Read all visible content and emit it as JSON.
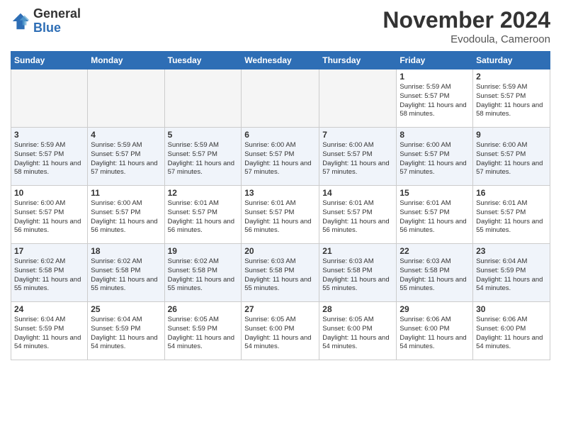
{
  "header": {
    "logo_general": "General",
    "logo_blue": "Blue",
    "month_title": "November 2024",
    "location": "Evodoula, Cameroon"
  },
  "weekdays": [
    "Sunday",
    "Monday",
    "Tuesday",
    "Wednesday",
    "Thursday",
    "Friday",
    "Saturday"
  ],
  "weeks": [
    [
      {
        "day": "",
        "empty": true
      },
      {
        "day": "",
        "empty": true
      },
      {
        "day": "",
        "empty": true
      },
      {
        "day": "",
        "empty": true
      },
      {
        "day": "",
        "empty": true
      },
      {
        "day": "1",
        "sunrise": "Sunrise: 5:59 AM",
        "sunset": "Sunset: 5:57 PM",
        "daylight": "Daylight: 11 hours and 58 minutes."
      },
      {
        "day": "2",
        "sunrise": "Sunrise: 5:59 AM",
        "sunset": "Sunset: 5:57 PM",
        "daylight": "Daylight: 11 hours and 58 minutes."
      }
    ],
    [
      {
        "day": "3",
        "sunrise": "Sunrise: 5:59 AM",
        "sunset": "Sunset: 5:57 PM",
        "daylight": "Daylight: 11 hours and 58 minutes."
      },
      {
        "day": "4",
        "sunrise": "Sunrise: 5:59 AM",
        "sunset": "Sunset: 5:57 PM",
        "daylight": "Daylight: 11 hours and 57 minutes."
      },
      {
        "day": "5",
        "sunrise": "Sunrise: 5:59 AM",
        "sunset": "Sunset: 5:57 PM",
        "daylight": "Daylight: 11 hours and 57 minutes."
      },
      {
        "day": "6",
        "sunrise": "Sunrise: 6:00 AM",
        "sunset": "Sunset: 5:57 PM",
        "daylight": "Daylight: 11 hours and 57 minutes."
      },
      {
        "day": "7",
        "sunrise": "Sunrise: 6:00 AM",
        "sunset": "Sunset: 5:57 PM",
        "daylight": "Daylight: 11 hours and 57 minutes."
      },
      {
        "day": "8",
        "sunrise": "Sunrise: 6:00 AM",
        "sunset": "Sunset: 5:57 PM",
        "daylight": "Daylight: 11 hours and 57 minutes."
      },
      {
        "day": "9",
        "sunrise": "Sunrise: 6:00 AM",
        "sunset": "Sunset: 5:57 PM",
        "daylight": "Daylight: 11 hours and 57 minutes."
      }
    ],
    [
      {
        "day": "10",
        "sunrise": "Sunrise: 6:00 AM",
        "sunset": "Sunset: 5:57 PM",
        "daylight": "Daylight: 11 hours and 56 minutes."
      },
      {
        "day": "11",
        "sunrise": "Sunrise: 6:00 AM",
        "sunset": "Sunset: 5:57 PM",
        "daylight": "Daylight: 11 hours and 56 minutes."
      },
      {
        "day": "12",
        "sunrise": "Sunrise: 6:01 AM",
        "sunset": "Sunset: 5:57 PM",
        "daylight": "Daylight: 11 hours and 56 minutes."
      },
      {
        "day": "13",
        "sunrise": "Sunrise: 6:01 AM",
        "sunset": "Sunset: 5:57 PM",
        "daylight": "Daylight: 11 hours and 56 minutes."
      },
      {
        "day": "14",
        "sunrise": "Sunrise: 6:01 AM",
        "sunset": "Sunset: 5:57 PM",
        "daylight": "Daylight: 11 hours and 56 minutes."
      },
      {
        "day": "15",
        "sunrise": "Sunrise: 6:01 AM",
        "sunset": "Sunset: 5:57 PM",
        "daylight": "Daylight: 11 hours and 56 minutes."
      },
      {
        "day": "16",
        "sunrise": "Sunrise: 6:01 AM",
        "sunset": "Sunset: 5:57 PM",
        "daylight": "Daylight: 11 hours and 55 minutes."
      }
    ],
    [
      {
        "day": "17",
        "sunrise": "Sunrise: 6:02 AM",
        "sunset": "Sunset: 5:58 PM",
        "daylight": "Daylight: 11 hours and 55 minutes."
      },
      {
        "day": "18",
        "sunrise": "Sunrise: 6:02 AM",
        "sunset": "Sunset: 5:58 PM",
        "daylight": "Daylight: 11 hours and 55 minutes."
      },
      {
        "day": "19",
        "sunrise": "Sunrise: 6:02 AM",
        "sunset": "Sunset: 5:58 PM",
        "daylight": "Daylight: 11 hours and 55 minutes."
      },
      {
        "day": "20",
        "sunrise": "Sunrise: 6:03 AM",
        "sunset": "Sunset: 5:58 PM",
        "daylight": "Daylight: 11 hours and 55 minutes."
      },
      {
        "day": "21",
        "sunrise": "Sunrise: 6:03 AM",
        "sunset": "Sunset: 5:58 PM",
        "daylight": "Daylight: 11 hours and 55 minutes."
      },
      {
        "day": "22",
        "sunrise": "Sunrise: 6:03 AM",
        "sunset": "Sunset: 5:58 PM",
        "daylight": "Daylight: 11 hours and 55 minutes."
      },
      {
        "day": "23",
        "sunrise": "Sunrise: 6:04 AM",
        "sunset": "Sunset: 5:59 PM",
        "daylight": "Daylight: 11 hours and 54 minutes."
      }
    ],
    [
      {
        "day": "24",
        "sunrise": "Sunrise: 6:04 AM",
        "sunset": "Sunset: 5:59 PM",
        "daylight": "Daylight: 11 hours and 54 minutes."
      },
      {
        "day": "25",
        "sunrise": "Sunrise: 6:04 AM",
        "sunset": "Sunset: 5:59 PM",
        "daylight": "Daylight: 11 hours and 54 minutes."
      },
      {
        "day": "26",
        "sunrise": "Sunrise: 6:05 AM",
        "sunset": "Sunset: 5:59 PM",
        "daylight": "Daylight: 11 hours and 54 minutes."
      },
      {
        "day": "27",
        "sunrise": "Sunrise: 6:05 AM",
        "sunset": "Sunset: 6:00 PM",
        "daylight": "Daylight: 11 hours and 54 minutes."
      },
      {
        "day": "28",
        "sunrise": "Sunrise: 6:05 AM",
        "sunset": "Sunset: 6:00 PM",
        "daylight": "Daylight: 11 hours and 54 minutes."
      },
      {
        "day": "29",
        "sunrise": "Sunrise: 6:06 AM",
        "sunset": "Sunset: 6:00 PM",
        "daylight": "Daylight: 11 hours and 54 minutes."
      },
      {
        "day": "30",
        "sunrise": "Sunrise: 6:06 AM",
        "sunset": "Sunset: 6:00 PM",
        "daylight": "Daylight: 11 hours and 54 minutes."
      }
    ]
  ]
}
